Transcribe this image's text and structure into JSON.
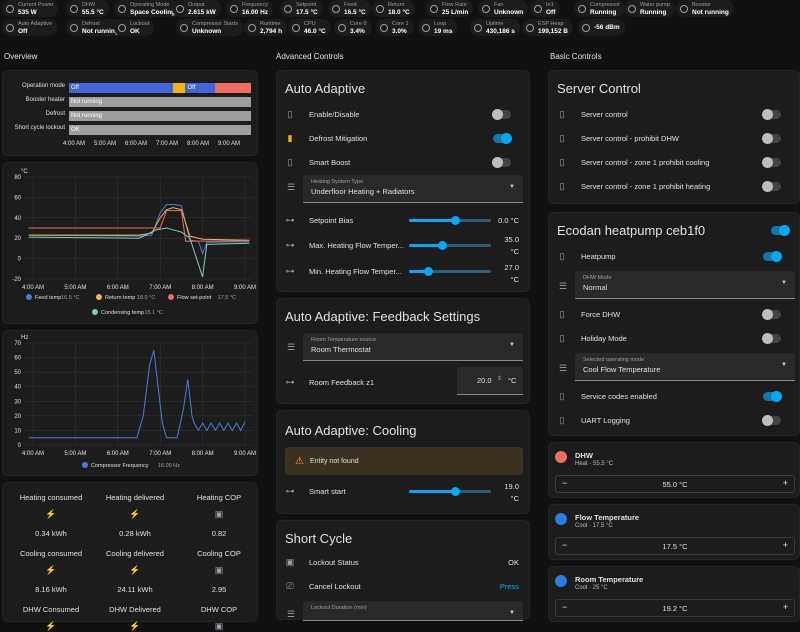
{
  "topbar": [
    {
      "label": "Current Power",
      "value": "535 W",
      "icon": "flash-icon"
    },
    {
      "label": "DHW",
      "value": "55.5 °C",
      "icon": "thermometer-icon"
    },
    {
      "label": "Operating Mode",
      "value": "Space Cooling",
      "icon": "eye-icon"
    },
    {
      "label": "Output",
      "value": "2.615 kW",
      "icon": "gauge-icon"
    },
    {
      "label": "Frequency",
      "value": "16.00 Hz",
      "icon": "sine-wave-icon"
    },
    {
      "label": "Setpoint",
      "value": "17.5 °C",
      "icon": "thermometer-icon"
    },
    {
      "label": "Feed",
      "value": "16.5 °C",
      "icon": "thermometer-icon"
    },
    {
      "label": "Return",
      "value": "18.0 °C",
      "icon": "thermometer-icon"
    },
    {
      "label": "Flow Rate",
      "value": "25 L/min",
      "icon": "water-icon"
    },
    {
      "label": "Fan",
      "value": "Unknown",
      "icon": "fan-icon"
    },
    {
      "label": "In1",
      "value": "Off",
      "icon": "input-icon"
    },
    {
      "label": "Compressor",
      "value": "Running",
      "icon": "compressor-icon"
    },
    {
      "label": "Water pump",
      "value": "Running",
      "icon": "pump-icon"
    },
    {
      "label": "Booster",
      "value": "Not running",
      "icon": "heater-icon"
    },
    {
      "label": "Auto Adaptive",
      "value": "Off",
      "icon": "tune-icon"
    },
    {
      "label": "Defrost",
      "value": "Not running",
      "icon": "snowflake-icon"
    },
    {
      "label": "Lockout",
      "value": "OK",
      "icon": "lock-icon"
    },
    {
      "label": "Compressor Starts",
      "value": "Unknown",
      "icon": "counter-icon"
    },
    {
      "label": "Runtime",
      "value": "2,794 h",
      "icon": "timer-icon"
    },
    {
      "label": "CPU",
      "value": "46.0 °C",
      "icon": "chip-icon"
    },
    {
      "label": "Core 0",
      "value": "3.4%",
      "icon": "chip-icon"
    },
    {
      "label": "Core 1",
      "value": "3.0%",
      "icon": "chip-icon"
    },
    {
      "label": "Loop",
      "value": "19 ms",
      "icon": "loop-icon"
    },
    {
      "label": "Uptime",
      "value": "430,186 s",
      "icon": "clock-icon"
    },
    {
      "label": "ESP Heap",
      "value": "199,152 B",
      "icon": "memory-icon"
    },
    {
      "label": "",
      "value": "-56 dBm",
      "icon": "wifi-icon"
    }
  ],
  "columns": {
    "overview": "Overview",
    "advanced": "Advanced Controls",
    "basic": "Basic Controls"
  },
  "timeline": {
    "rows": [
      {
        "label": "Operation mode",
        "segments": [
          {
            "text": "Off",
            "color": "#3f67d8",
            "from": 0,
            "to": 0.57
          },
          {
            "text": "",
            "color": "#f4b400",
            "from": 0.57,
            "to": 0.64
          },
          {
            "text": "Off",
            "color": "#3f67d8",
            "from": 0.64,
            "to": 0.8
          },
          {
            "text": "",
            "color": "#ef6d5e",
            "from": 0.8,
            "to": 1
          }
        ]
      },
      {
        "label": "Booster heater",
        "segments": [
          {
            "text": "Not running",
            "color": "#9e9e9e",
            "from": 0,
            "to": 1
          }
        ]
      },
      {
        "label": "Defrost",
        "segments": [
          {
            "text": "Not running",
            "color": "#9e9e9e",
            "from": 0,
            "to": 1
          }
        ]
      },
      {
        "label": "Short cycle lockout",
        "segments": [
          {
            "text": "OK",
            "color": "#9e9e9e",
            "from": 0,
            "to": 1
          }
        ]
      }
    ],
    "ticks": [
      "4:00 AM",
      "5:00 AM",
      "6:00 AM",
      "7:00 AM",
      "8:00 AM",
      "9:00 AM"
    ]
  },
  "chart_data": [
    {
      "type": "line",
      "ylabel": "°C",
      "ylim": [
        -20,
        80
      ],
      "yticks": [
        -20,
        0,
        20,
        40,
        60,
        80
      ],
      "x": [
        "4:00 AM",
        "5:00 AM",
        "6:00 AM",
        "7:00 AM",
        "8:00 AM",
        "9:00 AM"
      ],
      "series": [
        {
          "name": "Feed temp",
          "color": "#4b7bd8",
          "current": "16.5 °C"
        },
        {
          "name": "Return temp",
          "color": "#f5b642",
          "current": "18.0 °C"
        },
        {
          "name": "Flow set-point",
          "color": "#ef6d5e",
          "current": "17.5 °C"
        },
        {
          "name": "Condensing temp",
          "color": "#7fc9c1",
          "current": "15.1 °C"
        }
      ]
    },
    {
      "type": "line",
      "ylabel": "Hz",
      "ylim": [
        0,
        70
      ],
      "yticks": [
        0,
        10,
        20,
        30,
        40,
        50,
        60,
        70
      ],
      "x": [
        "4:00 AM",
        "5:00 AM",
        "6:00 AM",
        "7:00 AM",
        "8:00 AM",
        "9:00 AM"
      ],
      "series": [
        {
          "name": "Compressor Frequency",
          "color": "#4b7bd8",
          "current": "16.00 Hz"
        }
      ]
    }
  ],
  "energy": [
    {
      "label": "Heating consumed",
      "value": "0.34 kWh"
    },
    {
      "label": "Heating delivered",
      "value": "0.28 kWh"
    },
    {
      "label": "Heating COP",
      "value": "0.82"
    },
    {
      "label": "Cooling consumed",
      "value": "8.16 kWh"
    },
    {
      "label": "Cooling delivered",
      "value": "24.11 kWh"
    },
    {
      "label": "Cooling COP",
      "value": "2.95"
    },
    {
      "label": "DHW Consumed",
      "value": ""
    },
    {
      "label": "DHW Delivered",
      "value": ""
    },
    {
      "label": "DHW COP",
      "value": ""
    }
  ],
  "auto_adaptive": {
    "title": "Auto Adaptive",
    "enable": "Enable/Disable",
    "defrost": "Defrost Mitigation",
    "smart": "Smart Boost",
    "hs_label": "Heating System Type",
    "hs_value": "Underfloor Heating + Radiators",
    "bias_label": "Setpoint Bias",
    "bias_value": "0.0 °C",
    "maxf_label": "Max. Heating Flow Temper...",
    "maxf_value": "35.0",
    "maxf_unit": "°C",
    "minf_label": "Min. Heating Flow Temper...",
    "minf_value": "27.0",
    "minf_unit": "°C"
  },
  "feedback": {
    "title": "Auto Adaptive: Feedback Settings",
    "rt_label": "Room Temperature source",
    "rt_value": "Room Thermostat",
    "fb_label": "Room Feedback z1",
    "fb_value": "20.0",
    "fb_unit": "°C"
  },
  "cooling": {
    "title": "Auto Adaptive: Cooling",
    "warn": "Entity not found",
    "smart_label": "Smart start",
    "smart_value": "19.0",
    "smart_unit": "°C"
  },
  "shortcycle": {
    "title": "Short Cycle",
    "lock_label": "Lockout Status",
    "lock_value": "OK",
    "cancel_label": "Cancel Lockout",
    "cancel_value": "Press",
    "dur_label": "Lockout Duration (min)"
  },
  "server": {
    "title": "Server Control",
    "items": [
      "Server control",
      "Server control - prohibit DHW",
      "Server control - zone 1 prohibit cooling",
      "Server control - zone 1 prohibit heating"
    ]
  },
  "ecodan": {
    "title": "Ecodan heatpump ceb1f0",
    "heatpump": "Heatpump",
    "dhw_mode_label": "DHW Mode",
    "dhw_mode_value": "Normal",
    "force": "Force DHW",
    "holiday": "Holiday Mode",
    "op_label": "Selected operating mode",
    "op_value": "Cool Flow Temperature",
    "service": "Service codes enabled",
    "uart": "UART Logging"
  },
  "thermo": [
    {
      "title": "DHW",
      "sub": "Heat · 55.5 °C",
      "value": "55.0 °C",
      "minus": "−",
      "plus": "+"
    },
    {
      "title": "Flow Temperature",
      "sub": "Cool · 17.5 °C",
      "value": "17.5 °C",
      "minus": "−",
      "plus": "+"
    },
    {
      "title": "Room Temperature",
      "sub": "Cool · 25 °C",
      "value": "19.2 °C",
      "minus": "−",
      "plus": "+"
    }
  ]
}
